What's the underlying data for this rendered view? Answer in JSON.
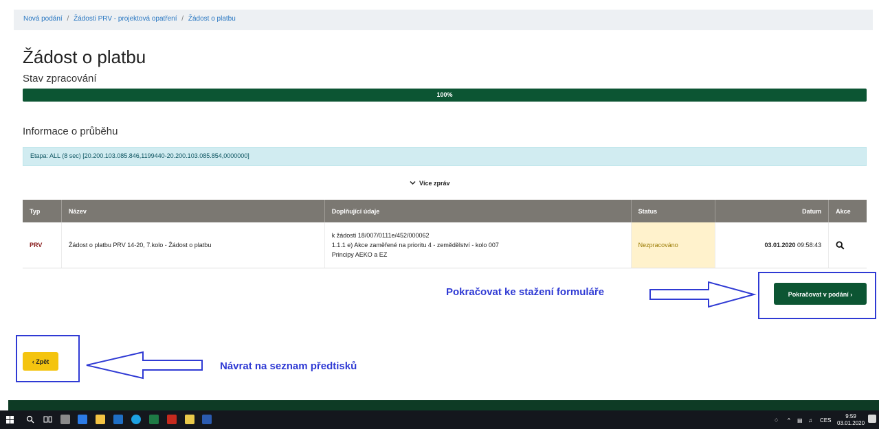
{
  "breadcrumb": [
    "Nová podání",
    "Žádosti PRV - projektová opatření",
    "Žádost o platbu"
  ],
  "page_title": "Žádost o platbu",
  "status_section": {
    "label": "Stav zpracování",
    "progress_percent": 100,
    "progress_label": "100%"
  },
  "info_section": {
    "label": "Informace o průběhu",
    "message": "Etapa: ALL (8 sec) [20.200.103.085.846,1199440-20.200.103.085.854,0000000]",
    "more_messages": "Více zpráv"
  },
  "table": {
    "headers": {
      "type": "Typ",
      "name": "Název",
      "details": "Doplňující údaje",
      "status": "Status",
      "date": "Datum",
      "actions": "Akce"
    },
    "rows": [
      {
        "type": "PRV",
        "name": "Žádost o platbu PRV 14-20, 7.kolo - Žádost o platbu",
        "details": [
          "k žádosti 18/007/0111e/452/000062",
          "1.1.1 e) Akce zaměřené na prioritu 4 - zemědělství - kolo 007",
          "Principy AEKO a EZ"
        ],
        "status": "Nezpracováno",
        "date_bold": "03.01.2020",
        "date_time": "09:58:43",
        "action_icon": "search-icon"
      }
    ]
  },
  "annotations": {
    "continue_hint": "Pokračovat ke stažení formuláře",
    "back_hint": "Návrat na seznam předtisků"
  },
  "buttons": {
    "continue_label": "Pokračovat v podání ›",
    "back_label": "‹ Zpět"
  },
  "taskbar": {
    "lang": "CES",
    "time": "9:59",
    "date": "03.01.2020"
  },
  "colors": {
    "primary_green": "#0c5533",
    "accent_yellow": "#f4c40f",
    "annotation_blue": "#2f3ad4",
    "status_bg": "#fff2cc"
  }
}
